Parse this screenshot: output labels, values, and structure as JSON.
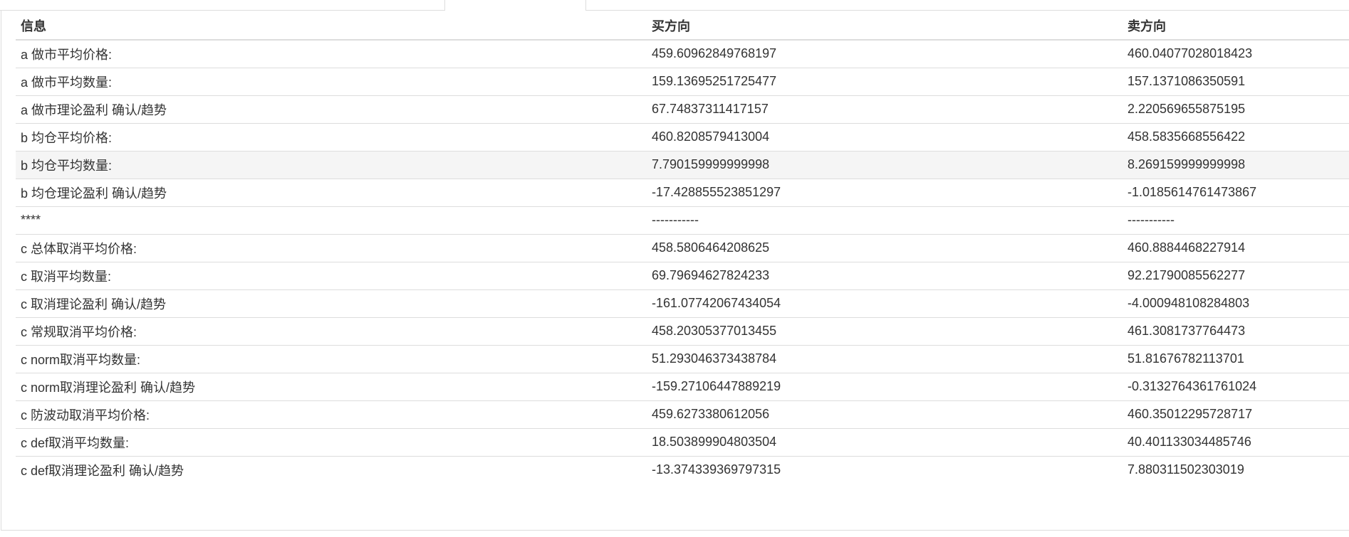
{
  "table": {
    "headers": [
      "信息",
      "买方向",
      "卖方向"
    ],
    "rows": [
      [
        "a 做市平均价格:",
        "459.60962849768197",
        "460.04077028018423"
      ],
      [
        "a 做市平均数量:",
        "159.13695251725477",
        "157.1371086350591"
      ],
      [
        "a 做市理论盈利 确认/趋势",
        "67.74837311417157",
        "2.220569655875195"
      ],
      [
        "b 均仓平均价格:",
        "460.8208579413004",
        "458.5835668556422"
      ],
      [
        "b 均仓平均数量:",
        "7.790159999999998",
        "8.269159999999998"
      ],
      [
        "b 均仓理论盈利 确认/趋势",
        "-17.428855523851297",
        "-1.0185614761473867"
      ],
      [
        "****",
        "-----------",
        "-----------"
      ],
      [
        "c 总体取消平均价格:",
        "458.5806464208625",
        "460.8884468227914"
      ],
      [
        "c 取消平均数量:",
        "69.79694627824233",
        "92.21790085562277"
      ],
      [
        "c 取消理论盈利 确认/趋势",
        "-161.07742067434054",
        "-4.000948108284803"
      ],
      [
        "c 常规取消平均价格:",
        "458.20305377013455",
        "461.3081737764473"
      ],
      [
        "c norm取消平均数量:",
        "51.293046373438784",
        "51.81676782113701"
      ],
      [
        "c norm取消理论盈利 确认/趋势",
        "-159.27106447889219",
        "-0.3132764361761024"
      ],
      [
        "c 防波动取消平均价格:",
        "459.6273380612056",
        "460.35012295728717"
      ],
      [
        "c def取消平均数量:",
        "18.503899904803504",
        "40.401133034485746"
      ],
      [
        "c def取消理论盈利 确认/趋势",
        "-13.374339369797315",
        "7.880311502303019"
      ]
    ],
    "highlighted_row": 4
  },
  "colors": {
    "border": "#dddddd",
    "text": "#333333",
    "hover_row": "#f5f5f5"
  }
}
